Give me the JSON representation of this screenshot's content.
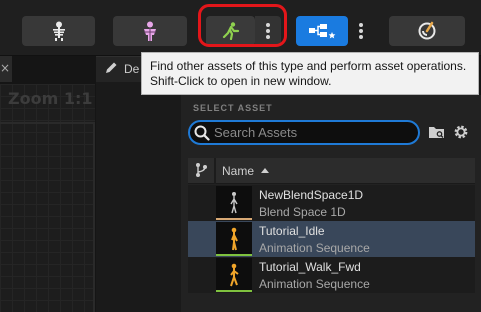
{
  "toolbar": {
    "buttons": [
      {
        "name": "skeleton",
        "icon": "skeleton-icon"
      },
      {
        "name": "skeletal-mesh",
        "icon": "mesh-icon"
      },
      {
        "name": "animation",
        "icon": "running-figure-icon",
        "highlighted": true
      },
      {
        "name": "blueprint",
        "icon": "blueprint-icon"
      },
      {
        "name": "physics",
        "icon": "physics-icon"
      }
    ],
    "highlight_color": "#e3161a",
    "accent_color": "#1a7be0"
  },
  "viewport": {
    "zoom_label": "Zoom 1:1",
    "close_glyph": "×"
  },
  "details": {
    "tab_label": "De"
  },
  "tooltip": {
    "line1": "Find other assets of this type and perform asset operations.",
    "line2": "Shift-Click to open in new window."
  },
  "asset_panel": {
    "section_label": "SELECT ASSET",
    "search": {
      "placeholder": "Search Assets",
      "value": ""
    },
    "column_header": "Name",
    "assets": [
      {
        "name": "NewBlendSpace1D",
        "type": "Blend Space 1D",
        "selected": false,
        "type_color": "#d7a874"
      },
      {
        "name": "Tutorial_Idle",
        "type": "Animation Sequence",
        "selected": true,
        "type_color": "#7fc23f"
      },
      {
        "name": "Tutorial_Walk_Fwd",
        "type": "Animation Sequence",
        "selected": false,
        "type_color": "#7fc23f"
      }
    ]
  }
}
